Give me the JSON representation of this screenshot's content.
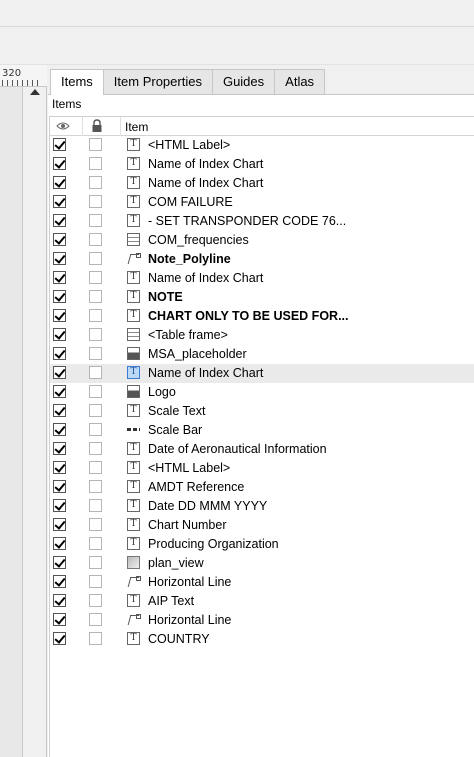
{
  "ruler": {
    "label": "320"
  },
  "tabs": [
    {
      "label": "Items",
      "active": true
    },
    {
      "label": "Item Properties",
      "active": false
    },
    {
      "label": "Guides",
      "active": false
    },
    {
      "label": "Atlas",
      "active": false
    }
  ],
  "items_panel": {
    "group_label": "Items",
    "columns": {
      "visibility_icon": "eye-icon",
      "lock_icon": "lock-icon",
      "item": "Item"
    },
    "rows": [
      {
        "label": "<HTML Label>",
        "icon": "text-icon",
        "visible": true,
        "locked": false,
        "bold": false
      },
      {
        "label": "Name of Index Chart",
        "icon": "text-icon",
        "visible": true,
        "locked": false,
        "bold": false
      },
      {
        "label": "Name of Index Chart",
        "icon": "text-icon",
        "visible": true,
        "locked": false,
        "bold": false
      },
      {
        "label": "COM FAILURE",
        "icon": "text-icon",
        "visible": true,
        "locked": false,
        "bold": false
      },
      {
        "label": "- SET TRANSPONDER CODE 76...",
        "icon": "text-icon",
        "visible": true,
        "locked": false,
        "bold": false
      },
      {
        "label": "COM_frequencies",
        "icon": "table-icon",
        "visible": true,
        "locked": false,
        "bold": false
      },
      {
        "label": "Note_Polyline",
        "icon": "polyline-icon",
        "visible": true,
        "locked": false,
        "bold": true
      },
      {
        "label": "Name of Index Chart",
        "icon": "text-icon",
        "visible": true,
        "locked": false,
        "bold": false
      },
      {
        "label": "NOTE",
        "icon": "text-icon",
        "visible": true,
        "locked": false,
        "bold": true
      },
      {
        "label": "CHART ONLY TO BE USED FOR...",
        "icon": "text-icon",
        "visible": true,
        "locked": false,
        "bold": true
      },
      {
        "label": "<Table frame>",
        "icon": "table-icon",
        "visible": true,
        "locked": false,
        "bold": false
      },
      {
        "label": "MSA_placeholder",
        "icon": "picture-icon",
        "visible": true,
        "locked": false,
        "bold": false
      },
      {
        "label": "Name of Index Chart",
        "icon": "text-icon",
        "visible": true,
        "locked": false,
        "bold": false,
        "selected": true
      },
      {
        "label": "Logo",
        "icon": "picture-icon",
        "visible": true,
        "locked": false,
        "bold": false
      },
      {
        "label": "Scale Text",
        "icon": "text-icon",
        "visible": true,
        "locked": false,
        "bold": false
      },
      {
        "label": "Scale Bar",
        "icon": "scalebar-icon",
        "visible": true,
        "locked": false,
        "bold": false
      },
      {
        "label": "Date of Aeronautical Information",
        "icon": "text-icon",
        "visible": true,
        "locked": false,
        "bold": false
      },
      {
        "label": "<HTML Label>",
        "icon": "text-icon",
        "visible": true,
        "locked": false,
        "bold": false
      },
      {
        "label": "AMDT Reference",
        "icon": "text-icon",
        "visible": true,
        "locked": false,
        "bold": false
      },
      {
        "label": "Date DD MMM YYYY",
        "icon": "text-icon",
        "visible": true,
        "locked": false,
        "bold": false
      },
      {
        "label": "Chart Number",
        "icon": "text-icon",
        "visible": true,
        "locked": false,
        "bold": false
      },
      {
        "label": "Producing Organization",
        "icon": "text-icon",
        "visible": true,
        "locked": false,
        "bold": false
      },
      {
        "label": "plan_view",
        "icon": "map-icon",
        "visible": true,
        "locked": false,
        "bold": false
      },
      {
        "label": "Horizontal Line",
        "icon": "polyline-icon",
        "visible": true,
        "locked": false,
        "bold": false
      },
      {
        "label": "AIP Text",
        "icon": "text-icon",
        "visible": true,
        "locked": false,
        "bold": false
      },
      {
        "label": "Horizontal Line",
        "icon": "polyline-icon",
        "visible": true,
        "locked": false,
        "bold": false
      },
      {
        "label": "COUNTRY",
        "icon": "text-icon",
        "visible": true,
        "locked": false,
        "bold": false
      }
    ]
  }
}
